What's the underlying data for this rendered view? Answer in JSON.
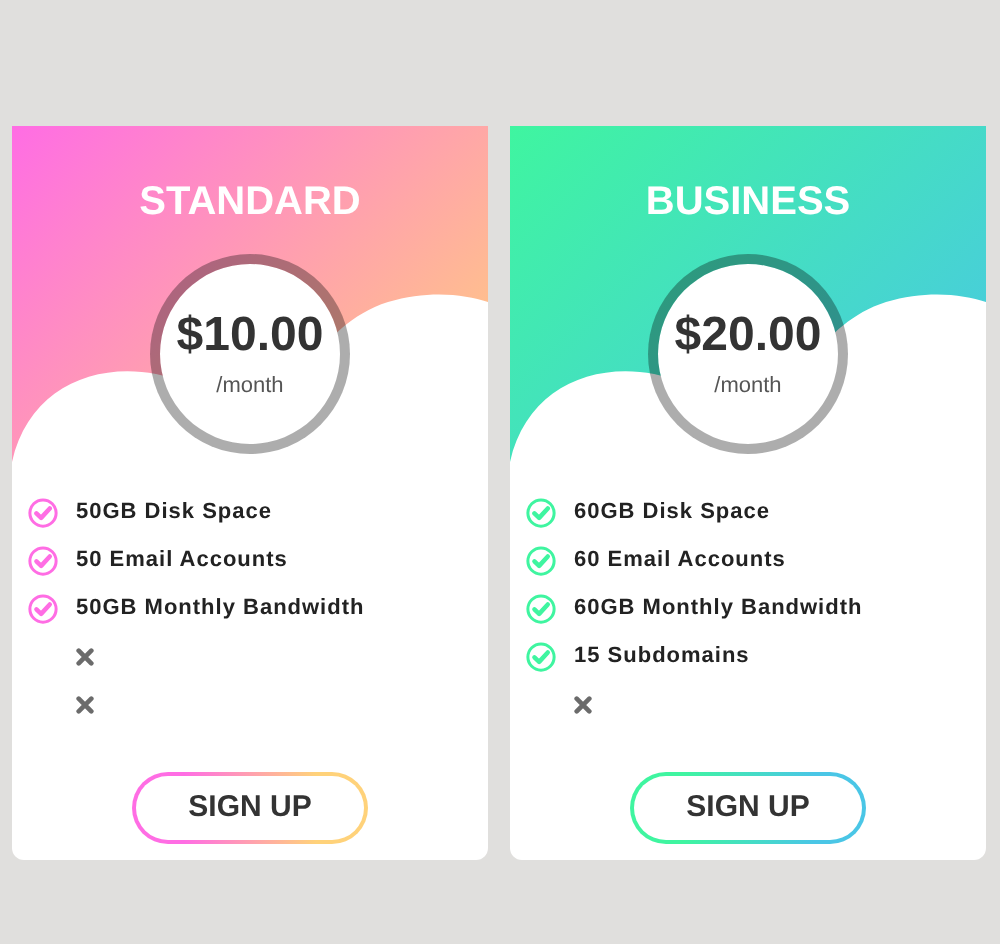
{
  "plans": [
    {
      "name": "STANDARD",
      "price": "$10.00",
      "period": "/month",
      "gradient": [
        {
          "color": "#ff6de4"
        },
        {
          "color": "#ffd27a"
        }
      ],
      "features": [
        {
          "included": true,
          "text": "50GB Disk Space"
        },
        {
          "included": true,
          "text": "50 Email Accounts"
        },
        {
          "included": true,
          "text": "50GB Monthly Bandwidth"
        },
        {
          "included": false
        },
        {
          "included": false
        }
      ],
      "button": "SIGN UP"
    },
    {
      "name": "BUSINESS",
      "price": "$20.00",
      "period": "/month",
      "gradient": [
        {
          "color": "#3ff5a0"
        },
        {
          "color": "#4ac6e6"
        }
      ],
      "features": [
        {
          "included": true,
          "text": "60GB Disk Space"
        },
        {
          "included": true,
          "text": "60 Email Accounts"
        },
        {
          "included": true,
          "text": "60GB Monthly Bandwidth"
        },
        {
          "included": true,
          "text": "15 Subdomains"
        },
        {
          "included": false
        }
      ],
      "button": "SIGN UP"
    }
  ]
}
